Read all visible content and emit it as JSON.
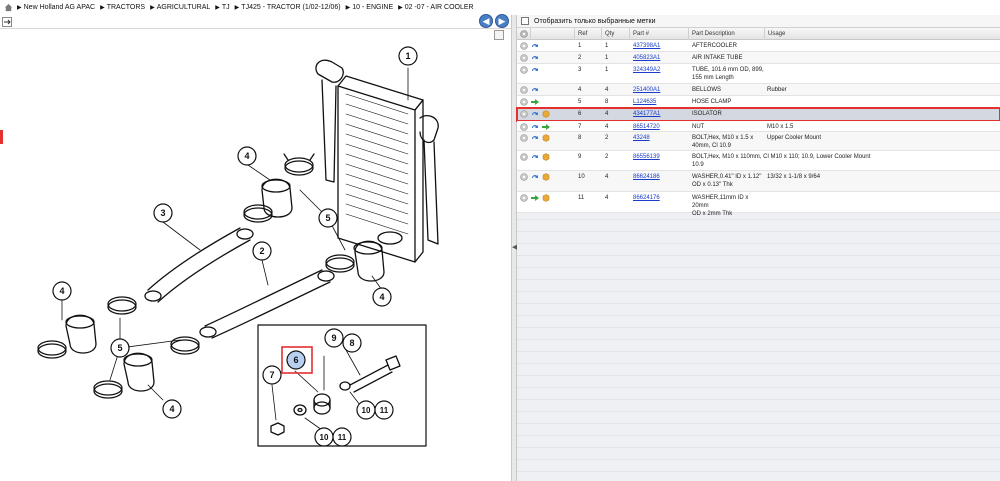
{
  "breadcrumb": [
    "New Holland AG APAC",
    "TRACTORS",
    "AGRICULTURAL",
    "TJ",
    "TJ425 - TRACTOR (1/02-12/06)",
    "10 - ENGINE",
    "02 -07 - AIR COOLER"
  ],
  "filter": {
    "label": "Отобразить только выбранные метки"
  },
  "columns": {
    "ref": "Ref",
    "qty": "Qty",
    "part": "Part #",
    "desc": "Part Description",
    "usage": "Usage"
  },
  "callouts": {
    "c1": "1",
    "c3": "3",
    "c4a": "4",
    "c4b": "4",
    "c4c": "4",
    "c4d": "4",
    "c2": "2",
    "c5a": "5",
    "c5b": "5",
    "c6": "6",
    "c7": "7",
    "c8": "8",
    "c9": "9",
    "c10a": "10",
    "c11a": "11",
    "c10b": "10",
    "c11b": "11"
  },
  "rows": [
    {
      "ref": "1",
      "qty": "1",
      "part": "437398A1",
      "desc1": "AFTERCOOLER",
      "desc2": "",
      "usage": "",
      "icon": "info"
    },
    {
      "ref": "2",
      "qty": "1",
      "part": "405823A1",
      "desc1": "AIR INTAKE TUBE",
      "desc2": "",
      "usage": "",
      "icon": "info"
    },
    {
      "ref": "3",
      "qty": "1",
      "part": "324349A2",
      "desc1": "TUBE, 101.6 mm OD, 899,",
      "desc2": "155 mm Length",
      "usage": "",
      "icon": "info"
    },
    {
      "ref": "4",
      "qty": "4",
      "part": "251400A1",
      "desc1": "BELLOWS",
      "desc2": "",
      "usage": "Rubber",
      "icon": "info"
    },
    {
      "ref": "5",
      "qty": "8",
      "part": "L124635",
      "desc1": "HOSE CLAMP",
      "desc2": "",
      "usage": "",
      "icon": "arrow"
    },
    {
      "ref": "6",
      "qty": "4",
      "part": "434177A1",
      "desc1": "ISOLATOR",
      "desc2": "",
      "usage": "",
      "icon": "info-box"
    },
    {
      "ref": "7",
      "qty": "4",
      "part": "86514720",
      "desc1": "NUT",
      "desc2": "",
      "usage": "M10 x 1.5",
      "icon": "info-arrow"
    },
    {
      "ref": "8",
      "qty": "2",
      "part": "43248",
      "desc1": "BOLT,Hex, M10 x 1.5 x",
      "desc2": "40mm, Cl 10.9",
      "usage": "Upper Cooler Mount",
      "icon": "info-box"
    },
    {
      "ref": "9",
      "qty": "2",
      "part": "86556139",
      "desc1": "BOLT,Hex, M10 x 110mm, Cl M10 x 110; 10.9, Lower Cooler Mount",
      "desc2": "10.9",
      "usage": "",
      "icon": "info-box"
    },
    {
      "ref": "10",
      "qty": "4",
      "part": "86624186",
      "desc1": "WASHER,0.41\" ID x 1.12\"",
      "desc2": "OD x 0.13\" Thk",
      "usage": "13/32 x 1-1/8 x 9/64",
      "icon": "info-box"
    },
    {
      "ref": "11",
      "qty": "4",
      "part": "86624176",
      "desc1": "WASHER,11mm ID x 20mm",
      "desc2": "OD x 2mm Thk",
      "usage": "",
      "icon": "arrow-box"
    }
  ],
  "colors": {
    "selected_outline": "#e53030",
    "link": "#1a3ccc",
    "callout_highlight": "#b9cff0"
  }
}
